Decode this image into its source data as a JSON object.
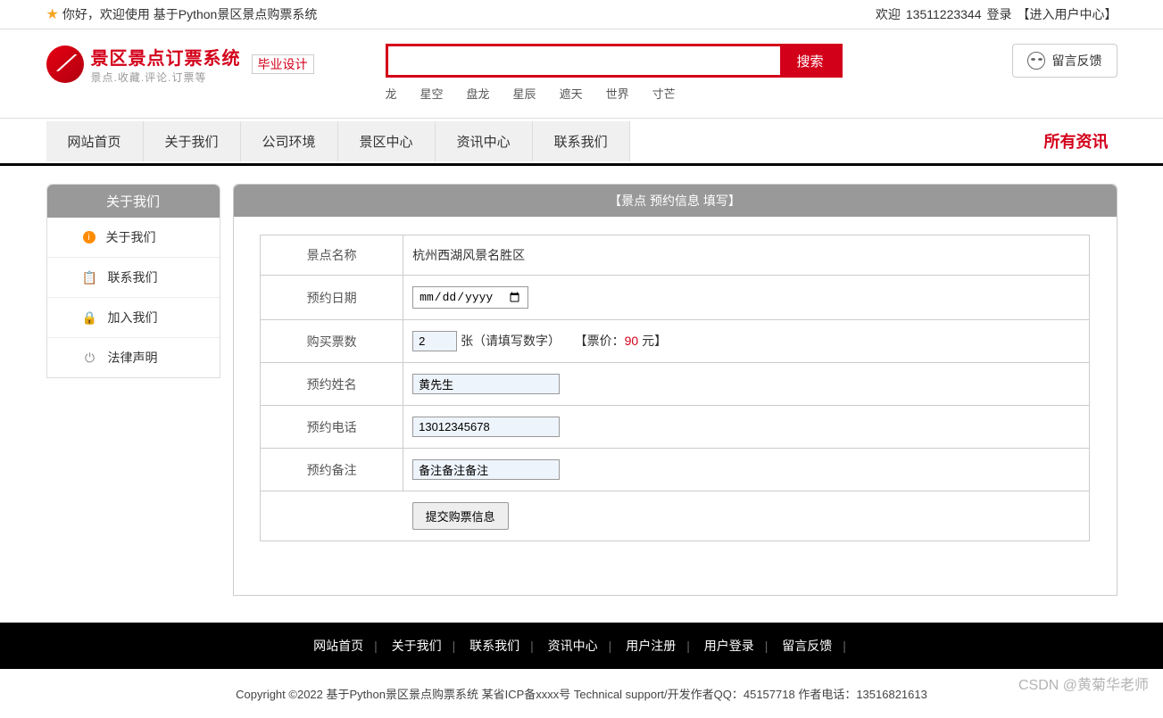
{
  "topbar": {
    "welcome": "你好，欢迎使用 基于Python景区景点购票系统",
    "right_welcome": "欢迎",
    "phone": "13511223344",
    "login": "登录",
    "user_center": "【进入用户中心】"
  },
  "logo": {
    "title": "景区景点订票系统",
    "subtitle": "景点.收藏.评论.订票等",
    "badge": "毕业设计"
  },
  "search": {
    "placeholder": "",
    "button": "搜索",
    "tags": [
      "龙",
      "星空",
      "盘龙",
      "星辰",
      "遮天",
      "世界",
      "寸芒"
    ]
  },
  "feedback": {
    "label": "留言反馈"
  },
  "nav": {
    "items": [
      "网站首页",
      "关于我们",
      "公司环境",
      "景区中心",
      "资讯中心",
      "联系我们"
    ],
    "right": "所有资讯"
  },
  "sidebar": {
    "header": "关于我们",
    "items": [
      {
        "label": "关于我们",
        "icon": "info"
      },
      {
        "label": "联系我们",
        "icon": "clipboard"
      },
      {
        "label": "加入我们",
        "icon": "lock"
      },
      {
        "label": "法律声明",
        "icon": "power"
      }
    ]
  },
  "panel": {
    "header": "【景点 预约信息 填写】",
    "rows": {
      "spot_label": "景点名称",
      "spot_value": "杭州西湖风景名胜区",
      "date_label": "预约日期",
      "date_placeholder": "年 /月/日",
      "qty_label": "购买票数",
      "qty_value": "2",
      "qty_suffix": "张（请填写数字）",
      "price_prefix": "【票价：",
      "price_value": "90",
      "price_unit": " 元】",
      "name_label": "预约姓名",
      "name_value": "黄先生",
      "phone_label": "预约电话",
      "phone_value": "13012345678",
      "remark_label": "预约备注",
      "remark_value": "备注备注备注",
      "submit": "提交购票信息"
    }
  },
  "footer": {
    "links": [
      "网站首页",
      "关于我们",
      "联系我们",
      "资讯中心",
      "用户注册",
      "用户登录",
      "留言反馈"
    ],
    "copyright": "Copyright ©2022 基于Python景区景点购票系统 某省ICP备xxxx号     Technical support/开发作者QQ：45157718     作者电话：13516821613"
  },
  "watermark": "CSDN @黄菊华老师"
}
